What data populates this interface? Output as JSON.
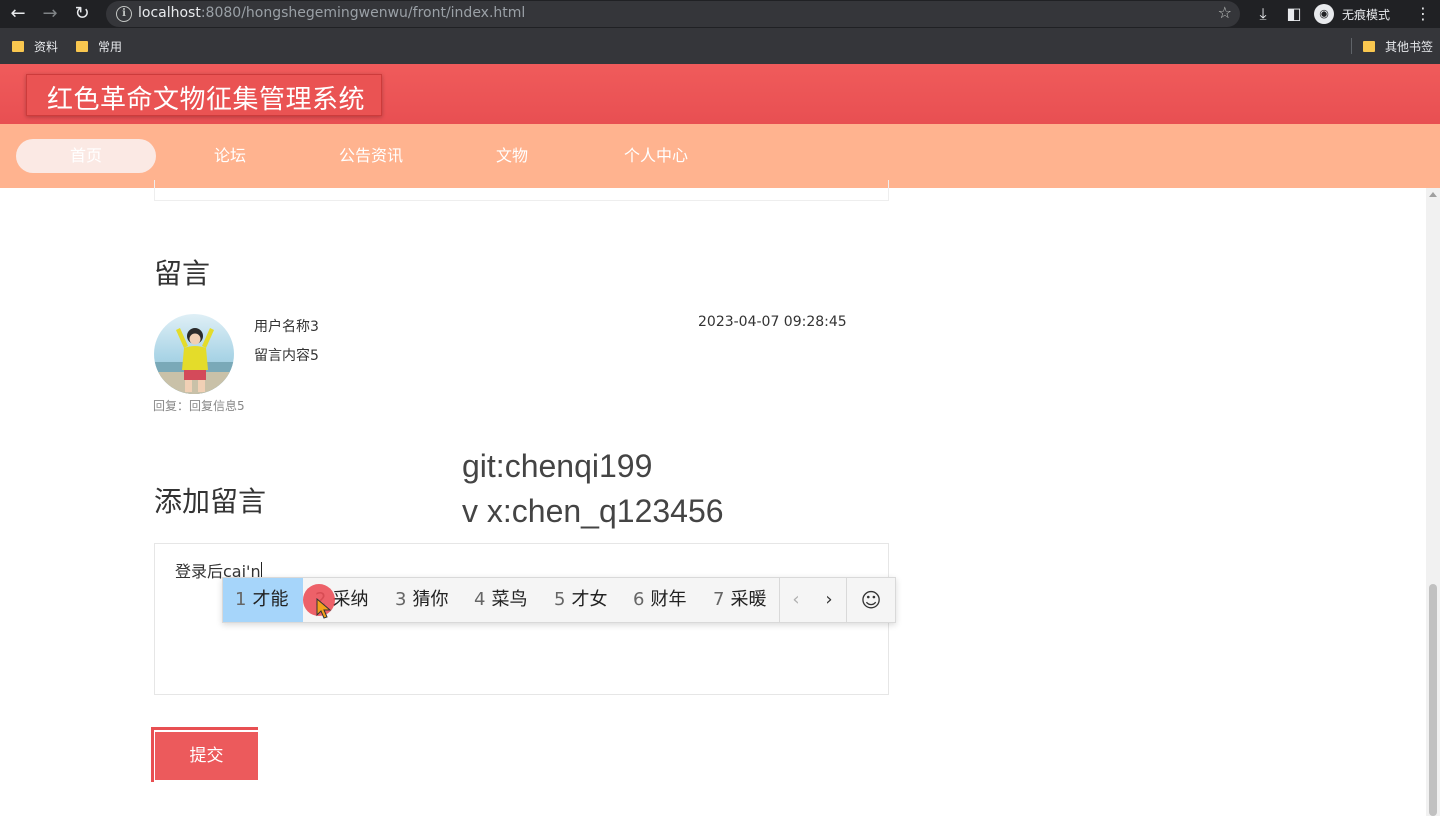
{
  "browser": {
    "url_host": "localhost",
    "url_rest": ":8080/hongshegemingwenwu/front/index.html",
    "incognito_label": "无痕模式",
    "bookmarks": [
      "资料",
      "常用"
    ],
    "other_bookmarks": "其他书签",
    "icons": [
      "back-icon",
      "forward-icon",
      "reload-icon",
      "info-icon",
      "star-icon",
      "download-icon",
      "sidepanel-icon",
      "incognito-icon",
      "menu-icon",
      "folder-icon"
    ]
  },
  "site": {
    "title": "红色革命文物征集管理系统",
    "nav": [
      "首页",
      "论坛",
      "公告资讯",
      "文物",
      "个人中心"
    ],
    "active_nav": "首页"
  },
  "comments": {
    "title": "留言",
    "items": [
      {
        "username": "用户名称3",
        "content": "留言内容5",
        "time": "2023-04-07 09:28:45",
        "reply": "回复：回复信息5"
      }
    ]
  },
  "watermark": {
    "line1": "git:chenqi199",
    "line2": "v x:chen_q123456"
  },
  "add_comment": {
    "title": "添加留言",
    "input_value": "登录后cai'n",
    "submit_label": "提交"
  },
  "ime": {
    "candidates": [
      {
        "num": "1",
        "text": "才能"
      },
      {
        "num": "2",
        "text": "采纳"
      },
      {
        "num": "3",
        "text": "猜你"
      },
      {
        "num": "4",
        "text": "菜鸟"
      },
      {
        "num": "5",
        "text": "才女"
      },
      {
        "num": "6",
        "text": "财年"
      },
      {
        "num": "7",
        "text": "采暖"
      }
    ],
    "selected_index": 0,
    "prev_glyph": "‹",
    "next_glyph": "›",
    "emoji_glyph": "☺"
  },
  "colors": {
    "header": "#e84f52",
    "nav": "#ffb38f",
    "ime_selected": "#a6d5fa",
    "submit": "#ec5a5c"
  }
}
